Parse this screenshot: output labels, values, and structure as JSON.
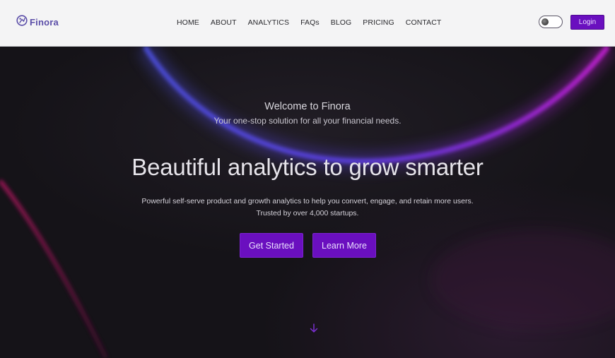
{
  "brand": {
    "name": "Finora"
  },
  "nav": {
    "items": [
      {
        "label": "HOME"
      },
      {
        "label": "ABOUT"
      },
      {
        "label": "ANALYTICS"
      },
      {
        "label": "FAQs"
      },
      {
        "label": "BLOG"
      },
      {
        "label": "PRICING"
      },
      {
        "label": "CONTACT"
      }
    ],
    "login_label": "Login"
  },
  "hero": {
    "welcome_title": "Welcome to Finora",
    "welcome_subtitle": "Your one-stop solution for all your financial needs.",
    "headline": "Beautiful analytics to grow smarter",
    "description_line1": "Powerful self-serve product and growth analytics to help you convert, engage, and retain more users.",
    "description_line2": "Trusted by over 4,000 startups.",
    "primary_button": "Get Started",
    "secondary_button": "Learn More"
  },
  "icons": {
    "logo": "finora-logo-icon",
    "toggle": "theme-toggle",
    "scroll": "arrow-down-icon"
  },
  "colors": {
    "accent": "#6a0fbf",
    "logo": "#5b4ea8",
    "hero_background": "#151318"
  }
}
